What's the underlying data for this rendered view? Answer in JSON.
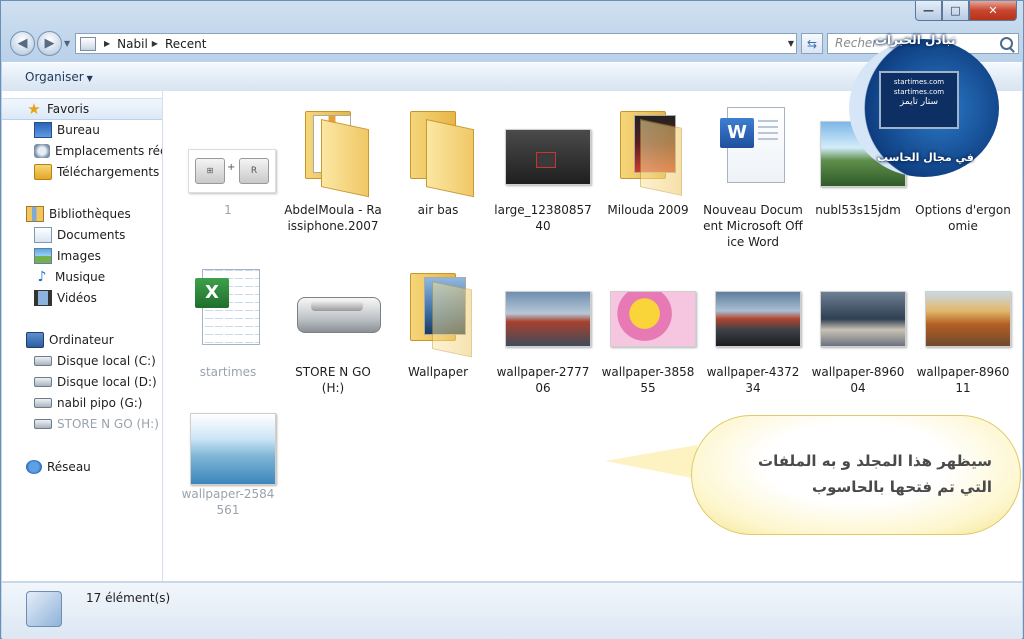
{
  "address": {
    "crumbs": [
      "Nabil",
      "Recent"
    ],
    "search_placeholder": "Recher"
  },
  "toolbar": {
    "organize_label": "Organiser"
  },
  "sidebar": {
    "favorites": {
      "label": "Favoris",
      "items": [
        "Bureau",
        "Emplacements récen",
        "Téléchargements"
      ]
    },
    "libraries": {
      "label": "Bibliothèques",
      "items": [
        "Documents",
        "Images",
        "Musique",
        "Vidéos"
      ]
    },
    "computer": {
      "label": "Ordinateur",
      "items": [
        "Disque local (C:)",
        "Disque local (D:)",
        "nabil  pipo (G:)",
        "STORE N GO (H:)"
      ]
    },
    "network": {
      "label": "Réseau"
    }
  },
  "items": [
    {
      "label": "1",
      "type": "image"
    },
    {
      "label": "AbdelMoula - Raissiphone.2007",
      "type": "folder"
    },
    {
      "label": "air bas",
      "type": "folder"
    },
    {
      "label": "large_1238085740",
      "type": "image"
    },
    {
      "label": "Milouda 2009",
      "type": "folder"
    },
    {
      "label": "Nouveau Document Microsoft Office Word",
      "type": "word-document"
    },
    {
      "label": "nubl53s15jdm",
      "type": "image"
    },
    {
      "label": "Options d'ergonomie",
      "type": "shortcut"
    },
    {
      "label": "startimes",
      "type": "excel-document"
    },
    {
      "label": "STORE N GO (H:)",
      "type": "drive"
    },
    {
      "label": "Wallpaper",
      "type": "folder"
    },
    {
      "label": "wallpaper-277706",
      "type": "image"
    },
    {
      "label": "wallpaper-385855",
      "type": "image"
    },
    {
      "label": "wallpaper-437234",
      "type": "image"
    },
    {
      "label": "wallpaper-896004",
      "type": "image"
    },
    {
      "label": "wallpaper-896011",
      "type": "image"
    },
    {
      "label": "wallpaper-2584561",
      "type": "image"
    }
  ],
  "status": {
    "count_text": "17 élément(s)"
  },
  "callout": {
    "line1": "سيظهر هذا المجلد و به الملفات",
    "line2": "التي تم فتحها بالحاسوب"
  },
  "logo": {
    "top_text": "تبادل الخبرات",
    "site_text": "startimes.com",
    "arabic_name": "ستار تايمز",
    "bottom_text": "في مجال الحاسب"
  }
}
